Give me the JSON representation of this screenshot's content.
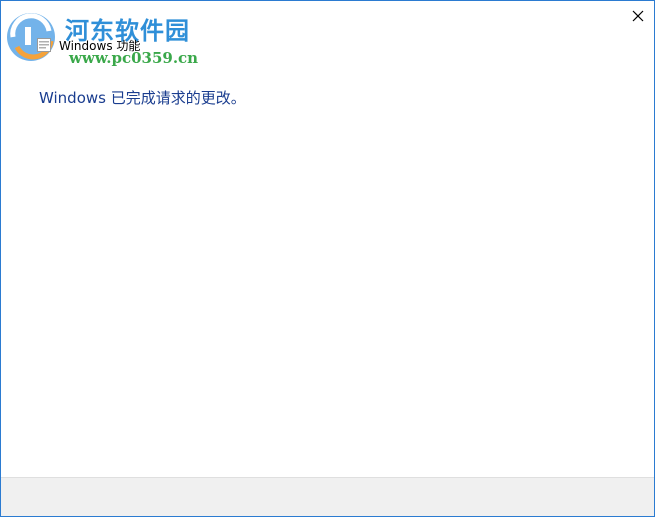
{
  "window": {
    "title": "Windows 功能",
    "close_symbol": "✕"
  },
  "watermark": {
    "site_name": "河东软件园",
    "url": "www.pc0359.cn"
  },
  "main": {
    "message": "Windows 已完成请求的更改。"
  },
  "colors": {
    "message_text": "#1a3d8f",
    "window_border": "#2b7bd1",
    "footer_bg": "#f0f0f0",
    "watermark_blue": "#2f8fd8",
    "watermark_green": "#3aa84a"
  }
}
